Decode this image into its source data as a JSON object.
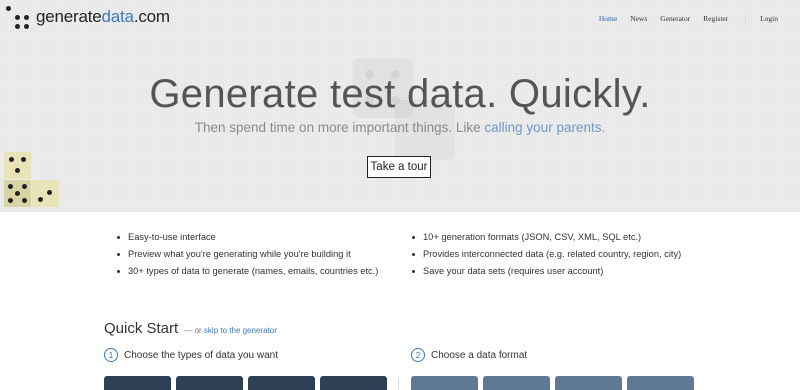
{
  "logo": {
    "text_main": "generate",
    "text_accent": "data",
    "text_suffix": ".com"
  },
  "nav": {
    "items": [
      "Home",
      "News",
      "Generator",
      "Register"
    ],
    "separator": "|",
    "login": "Login"
  },
  "hero": {
    "title": "Generate test data. Quickly.",
    "subtitle_prefix": "Then spend time on more important things. Like ",
    "subtitle_link": "calling your parents.",
    "tour_button": "Take a tour"
  },
  "features": {
    "left": [
      "Easy-to-use interface",
      "Preview what you're generating while you're building it",
      "30+ types of data to generate (names, emails, countries etc.)"
    ],
    "right": [
      "10+ generation formats (JSON, CSV, XML, SQL etc.)",
      "Provides interconnected data (e.g. related country, region, city)",
      "Save your data sets (requires user account)"
    ]
  },
  "quick_start": {
    "title": "Quick Start",
    "dash": "— or ",
    "skip_link": "skip to the generator",
    "step1": {
      "num": "1",
      "label": "Choose the types of data you want"
    },
    "step2": {
      "num": "2",
      "label": "Choose a data format"
    }
  },
  "colors": {
    "link_blue": "#3d7ab8",
    "tile_dark": "#2e4054",
    "tile_light": "#5f7895",
    "die_yellow": "#e8e3b8"
  }
}
